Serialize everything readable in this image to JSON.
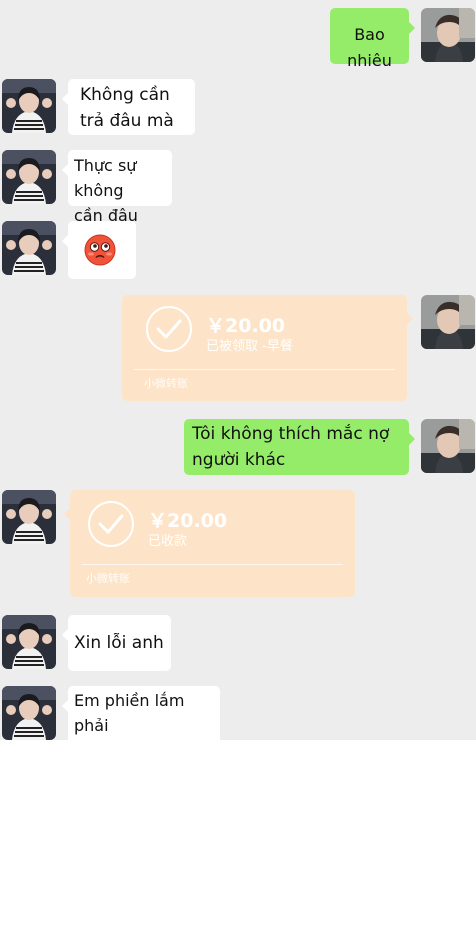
{
  "messages": {
    "m1": {
      "text": "Bao nhiêu"
    },
    "m2": {
      "text": "Không cần\ntrả đâu mà"
    },
    "m3": {
      "text": "Thực sự không\ncần đâu"
    },
    "m4": {
      "emoji": "flushed-face"
    },
    "m5": {
      "amount": "￥20.00",
      "status": "已被领取 -早餐",
      "footer": "小微转账"
    },
    "m6": {
      "text": "Tôi không thích mắc nợ\nngười khác"
    },
    "m7": {
      "amount": "￥20.00",
      "status": "已收款",
      "footer": "小微转账"
    },
    "m8": {
      "text": "Xin lỗi anh"
    },
    "m9": {
      "text": "Em phiền lắm phải\nkhông"
    }
  },
  "colors": {
    "chat_background": "#ededed",
    "incoming_bubble": "#ffffff",
    "outgoing_bubble": "#95ec69",
    "transfer_card": "#fde4c8"
  },
  "icons": {
    "self_avatar": "self-avatar",
    "contact_avatar": "contact-avatar",
    "transfer_check": "check-circle-icon"
  }
}
